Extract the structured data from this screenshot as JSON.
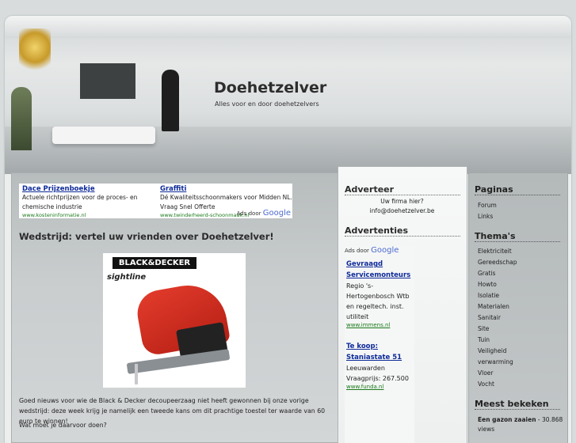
{
  "site": {
    "title": "Doehetzelver",
    "subtitle": "Alles voor en door doehetzelvers"
  },
  "main": {
    "ads": [
      {
        "title": "Dace Prijzenboekje",
        "desc": "Actuele richtprijzen voor de proces- en chemische industrie",
        "url": "www.kosteninformatie.nl"
      },
      {
        "title": "Graffiti",
        "desc": "Dé Kwaliteitsschoonmakers voor Midden NL. Vraag Snel Offerte",
        "url": "www.twinderheerd-schoonmaak.nl"
      }
    ],
    "ads_by_label": "Ads door",
    "google_label": "Google",
    "post_title": "Wedstrijd: vertel uw vrienden over Doehetzelver!",
    "product_brand": "BLACK&DECKER",
    "product_line": "sightline",
    "post_text": "Goed nieuws voor wie de Black & Decker decoupeerzaag niet heeft gewonnen bij onze vorige wedstrijd: deze week krijg je namelijk een tweede kans om dit prachtige toestel ter waarde van 60 euro te winnen!",
    "post_question": "Wat moet je daarvoor doen?"
  },
  "mid": {
    "adverteer_title": "Adverteer",
    "adverteer_line1": "Uw firma hier?",
    "adverteer_line2": "info@doehetzelver.be",
    "advertenties_title": "Advertenties",
    "ads_by_label": "Ads door",
    "google_label": "Google",
    "ads": [
      {
        "title": "Gevraagd Servicemonteurs",
        "desc": "Regio 's-Hertogenbosch Wtb en regeltech. inst. utiliteit",
        "url": "www.immens.nl"
      },
      {
        "title": "Te koop: Staniastate 51",
        "desc": "Leeuwarden Vraagprijs: 267.500",
        "url": "www.funda.nl"
      }
    ]
  },
  "right": {
    "paginas_title": "Paginas",
    "paginas": [
      "Forum",
      "Links"
    ],
    "themas_title": "Thema's",
    "themas": [
      "Elektriciteit",
      "Gereedschap",
      "Gratis",
      "Howto",
      "Isolatie",
      "Materialen",
      "Sanitair",
      "Site",
      "Tuin",
      "Veiligheid",
      "verwarming",
      "Vloer",
      "Vocht"
    ],
    "meest_title": "Meest bekeken",
    "meest_item": "Een gazon zaaien",
    "meest_views": " - 30.868 views"
  }
}
